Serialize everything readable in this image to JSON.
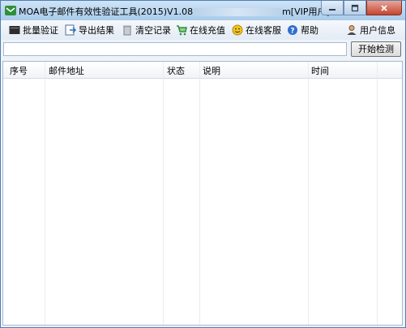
{
  "window": {
    "title_prefix": "MOA电子邮件有效性验证工具(2015)V1.08",
    "title_suffix": "m[VIP用户]"
  },
  "toolbar": {
    "batch_verify": "批量验证",
    "export_results": "导出结果",
    "clear_records": "清空记录",
    "online_recharge": "在线充值",
    "online_support": "在线客服",
    "help": "帮助",
    "user_info": "用户信息"
  },
  "input": {
    "value": "",
    "start_button": "开始检测"
  },
  "table": {
    "columns": [
      "序号",
      "邮件地址",
      "状态",
      "说明",
      "时间"
    ],
    "rows": []
  },
  "colors": {
    "titlebar": "#a9cbea",
    "close_button": "#c4452f",
    "window_border": "#4f7fb0"
  }
}
